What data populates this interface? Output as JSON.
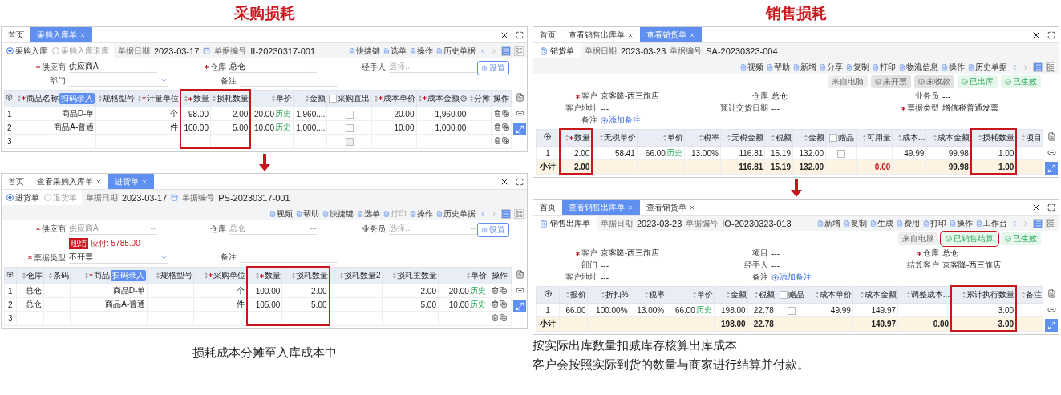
{
  "sections": [
    {
      "title": "采购损耗",
      "caption": [
        "损耗成本分摊至入库成本中"
      ],
      "windows": [
        {
          "tabs": [
            {
              "label": "首页",
              "selected": false
            },
            {
              "label": "采购入库单",
              "selected": true
            }
          ],
          "doc_types": [
            {
              "label": "采购入库",
              "selected": true
            },
            {
              "label": "采购入库退库",
              "selected": false
            }
          ],
          "date_label": "单据日期",
          "date": "2023-03-17",
          "number_label": "单据编号",
          "number": "II-20230317-001",
          "toolbar": [
            {
              "label": "快捷键"
            },
            {
              "label": "选单"
            },
            {
              "label": "操作"
            },
            {
              "label": "历史单据"
            }
          ],
          "settings_button": "设置",
          "field_rows": [
            [
              {
                "label": "供应商",
                "required": true,
                "kind": "picker",
                "value": "供应商A"
              },
              {
                "label": "仓库",
                "required": true,
                "kind": "picker",
                "value": "总仓"
              },
              {
                "label": "经手人",
                "required": false,
                "kind": "picker",
                "placeholder": "选择..."
              }
            ],
            [
              {
                "label": "部门",
                "required": false,
                "kind": "dropdown"
              },
              {
                "label": "备注",
                "required": false,
                "kind": "input"
              }
            ]
          ],
          "columns": [
            {
              "kind": "settings-index"
            },
            {
              "label": "商品名称",
              "required": true,
              "badge": "扫码录入"
            },
            {
              "label": "规格型号"
            },
            {
              "label": "计量单位",
              "required": true
            },
            {
              "label": "数量",
              "required": true,
              "highlighted": true
            },
            {
              "label": "损耗数量",
              "highlighted": true
            },
            {
              "label": "单价"
            },
            {
              "label": "金额"
            },
            {
              "label": "采购直出",
              "kind": "checkbox"
            },
            {
              "label": "成本单价",
              "required": true
            },
            {
              "label": "成本金额",
              "required": true,
              "help": true
            },
            {
              "label": "分摊"
            },
            {
              "label": "操作",
              "kind": "actions"
            }
          ],
          "rows": [
            {
              "cells": [
                "1",
                "商品D-单",
                null,
                "个",
                "98.00",
                "2.00",
                {
                  "value": "20.00",
                  "link": "历史"
                },
                "1,960....",
                {
                  "checked": false,
                  "disabled": false
                },
                "20.00",
                "1,960.00",
                null,
                null
              ]
            },
            {
              "cells": [
                "2",
                "商品A-普通",
                null,
                "件",
                "100.00",
                "5.00",
                {
                  "value": "10.00",
                  "link": "历史"
                },
                "1,000....",
                {
                  "checked": false,
                  "disabled": false
                },
                "10.00",
                "1,000.00",
                null,
                null
              ]
            },
            {
              "cells": [
                "3",
                null,
                null,
                null,
                null,
                null,
                null,
                null,
                {
                  "checked": false,
                  "disabled": true
                },
                null,
                null,
                null,
                null
              ]
            }
          ]
        },
        {
          "tabs": [
            {
              "label": "首页",
              "selected": false
            },
            {
              "label": "查看采购入库单",
              "selected": false
            },
            {
              "label": "进货单",
              "selected": true
            }
          ],
          "doc_types": [
            {
              "label": "进货单",
              "selected": true
            },
            {
              "label": "退货单",
              "selected": false
            }
          ],
          "date_label": "单据日期",
          "date": "2023-03-17",
          "number_label": "单据编号",
          "number": "PS-20230317-001",
          "toolbar": [
            {
              "label": "视频"
            },
            {
              "label": "帮助"
            },
            {
              "label": "快捷键"
            },
            {
              "label": "选单"
            },
            {
              "label": "打印",
              "disabled": true
            },
            {
              "label": "操作"
            },
            {
              "label": "历史单据"
            }
          ],
          "settings_button": "设置",
          "field_rows": [
            [
              {
                "label": "供应商",
                "required": true,
                "kind": "picker",
                "value": "供应商A",
                "muted": true,
                "note": {
                  "badge": "现结",
                  "text": "应付: 5785.00"
                }
              },
              {
                "label": "仓库",
                "required": false,
                "kind": "picker",
                "value": "总仓",
                "muted": true
              },
              {
                "label": "业务员",
                "required": false,
                "kind": "picker",
                "placeholder": "选择..."
              }
            ],
            [
              {
                "label": "票据类型",
                "required": true,
                "kind": "dropdown",
                "value": "不开票"
              },
              {
                "label": "备注",
                "required": false,
                "kind": "input"
              }
            ]
          ],
          "columns": [
            {
              "kind": "settings-index"
            },
            {
              "label": "仓库"
            },
            {
              "label": "条码"
            },
            {
              "label": "商品",
              "required": true,
              "badge": "扫码录入"
            },
            {
              "label": "规格型号"
            },
            {
              "label": "采购单位",
              "required": true
            },
            {
              "label": "数量",
              "required": true,
              "highlighted": true
            },
            {
              "label": "损耗数量",
              "highlighted": true
            },
            {
              "label": "损耗数量2"
            },
            {
              "label": "损耗主数量"
            },
            {
              "label": "单价"
            },
            {
              "label": "操作",
              "kind": "actions"
            }
          ],
          "rows": [
            {
              "cells": [
                "1",
                "总仓",
                null,
                "商品D-单",
                null,
                "个",
                "100.00",
                "2.00",
                null,
                "2.00",
                {
                  "value": "20.00",
                  "link": "历史"
                },
                null
              ]
            },
            {
              "cells": [
                "2",
                "总仓",
                null,
                "商品A-普通",
                null,
                "件",
                "105.00",
                "5.00",
                null,
                "5.00",
                {
                  "value": "10.00",
                  "link": "历史"
                },
                null
              ]
            },
            {
              "cells": [
                "3",
                null,
                null,
                null,
                null,
                null,
                null,
                null,
                null,
                null,
                null,
                null
              ]
            }
          ]
        }
      ]
    },
    {
      "title": "销售损耗",
      "caption": [
        "按实际出库数量扣减库存核算出库成本",
        "客户会按照实际到货的数量与商家进行结算并付款。"
      ],
      "windows": [
        {
          "tabs": [
            {
              "label": "首页",
              "selected": false
            },
            {
              "label": "查看销售出库单",
              "selected": false
            },
            {
              "label": "查看销货单",
              "selected": true
            }
          ],
          "doc_title": "销货单",
          "date_label": "单据日期",
          "date": "2023-03-23",
          "number_label": "单据编号",
          "number": "SA-20230323-004",
          "toolbar": [
            {
              "label": "视频"
            },
            {
              "label": "帮助"
            },
            {
              "label": "新增"
            },
            {
              "label": "分享"
            },
            {
              "label": "复制"
            },
            {
              "label": "打印"
            },
            {
              "label": "物流信息"
            },
            {
              "label": "操作"
            },
            {
              "label": "历史单据"
            }
          ],
          "status_tags": [
            {
              "label": "来自电脑",
              "kind": "plain"
            },
            {
              "label": "未开票",
              "kind": "pending"
            },
            {
              "label": "未收款",
              "kind": "pending"
            },
            {
              "label": "已出库",
              "kind": "done"
            },
            {
              "label": "已生效",
              "kind": "done"
            }
          ],
          "field_rows": [
            [
              {
                "label": "客户",
                "required": true,
                "kind": "text",
                "value": "京客隆-西三旗店"
              },
              {
                "label": "仓库",
                "required": false,
                "kind": "text",
                "value": "总仓"
              },
              {
                "label": "业务员",
                "required": false,
                "kind": "text",
                "value": "---"
              }
            ],
            [
              {
                "label": "客户地址",
                "required": false,
                "kind": "text",
                "value": "---"
              },
              {
                "label": "预计交货日期",
                "required": false,
                "kind": "text",
                "value": "---"
              },
              {
                "label": "票据类型",
                "required": true,
                "kind": "text",
                "value": "增值税普通发票"
              }
            ],
            [
              {
                "label": "备注",
                "required": false,
                "kind": "link",
                "value": "添加备注"
              }
            ]
          ],
          "columns": [
            {
              "kind": "add-index"
            },
            {
              "label": "数量",
              "required": true,
              "highlighted": true
            },
            {
              "label": "无税单价"
            },
            {
              "label": "单价"
            },
            {
              "label": "税率"
            },
            {
              "label": "无税金额"
            },
            {
              "label": "税额"
            },
            {
              "label": "金额"
            },
            {
              "label": "赠品",
              "kind": "checkbox"
            },
            {
              "label": "可用量"
            },
            {
              "label": "成本..."
            },
            {
              "label": "成本金额"
            },
            {
              "label": "损耗数量",
              "highlighted": true
            },
            {
              "label": "项目"
            }
          ],
          "rows": [
            {
              "subtotal": false,
              "cells": [
                "1",
                "2.00",
                "58.41",
                {
                  "value": "66.00",
                  "link": "历史"
                },
                "13.00%",
                "116.81",
                "15.19",
                "132.00",
                {
                  "checked": false,
                  "disabled": false
                },
                null,
                "49.99",
                "99.98",
                "1.00",
                null
              ]
            },
            {
              "subtotal": true,
              "cells": [
                "小计",
                "2.00",
                null,
                null,
                null,
                "116.81",
                "15.19",
                "132.00",
                null,
                {
                  "value": "0.00",
                  "alert": true
                },
                null,
                "99.98",
                "1.00",
                null
              ]
            }
          ]
        },
        {
          "tabs": [
            {
              "label": "首页",
              "selected": false
            },
            {
              "label": "查看销售出库单",
              "selected": true
            },
            {
              "label": "查看销货单",
              "selected": false
            }
          ],
          "doc_title": "销售出库单",
          "date_label": "单据日期",
          "date": "2023-03-23",
          "number_label": "单据编号",
          "number": "IO-20230323-013",
          "toolbar": [
            {
              "label": "新增"
            },
            {
              "label": "复制"
            },
            {
              "label": "生成"
            },
            {
              "label": "费用"
            },
            {
              "label": "打印"
            },
            {
              "label": "操作"
            },
            {
              "label": "工作台"
            }
          ],
          "status_tags": [
            {
              "label": "来自电脑",
              "kind": "plain"
            },
            {
              "label": "已销售结算",
              "kind": "done",
              "highlighted": true
            },
            {
              "label": "已生效",
              "kind": "done"
            }
          ],
          "field_rows": [
            [
              {
                "label": "客户",
                "required": true,
                "kind": "text",
                "value": "京客隆-西三旗店"
              },
              {
                "label": "项目",
                "required": false,
                "kind": "text",
                "value": "---"
              },
              {
                "label": "仓库",
                "required": true,
                "kind": "text",
                "value": "总仓"
              }
            ],
            [
              {
                "label": "部门",
                "required": false,
                "kind": "text",
                "value": "---"
              },
              {
                "label": "经手人",
                "required": false,
                "kind": "text",
                "value": "---"
              },
              {
                "label": "结算客户",
                "required": false,
                "kind": "text",
                "value": "京客隆-西三旗店"
              }
            ],
            [
              {
                "label": "客户地址",
                "required": false,
                "kind": "text",
                "value": "---"
              },
              {
                "label": "备注",
                "required": false,
                "kind": "link",
                "value": "添加备注"
              }
            ]
          ],
          "columns": [
            {
              "kind": "add-index"
            },
            {
              "label": "报价"
            },
            {
              "label": "折扣%"
            },
            {
              "label": "税率"
            },
            {
              "label": "单价"
            },
            {
              "label": "金额"
            },
            {
              "label": "税额"
            },
            {
              "label": "赠品",
              "kind": "checkbox"
            },
            {
              "label": "成本单价"
            },
            {
              "label": "成本金额"
            },
            {
              "label": "调整成本..."
            },
            {
              "label": "累计执行数量",
              "highlighted": true
            },
            {
              "label": "备注"
            }
          ],
          "rows": [
            {
              "subtotal": false,
              "cells": [
                "1",
                "66.00",
                "100.00%",
                "13.00%",
                {
                  "value": "66.00",
                  "link": "历史"
                },
                "198.00",
                "22.78",
                {
                  "checked": false,
                  "disabled": false
                },
                "49.99",
                "149.97",
                null,
                "3.00",
                null
              ]
            },
            {
              "subtotal": true,
              "cells": [
                "小计",
                null,
                null,
                null,
                null,
                "198.00",
                "22.78",
                null,
                null,
                "149.97",
                "0.00",
                "3.00",
                null
              ]
            }
          ]
        }
      ]
    }
  ]
}
